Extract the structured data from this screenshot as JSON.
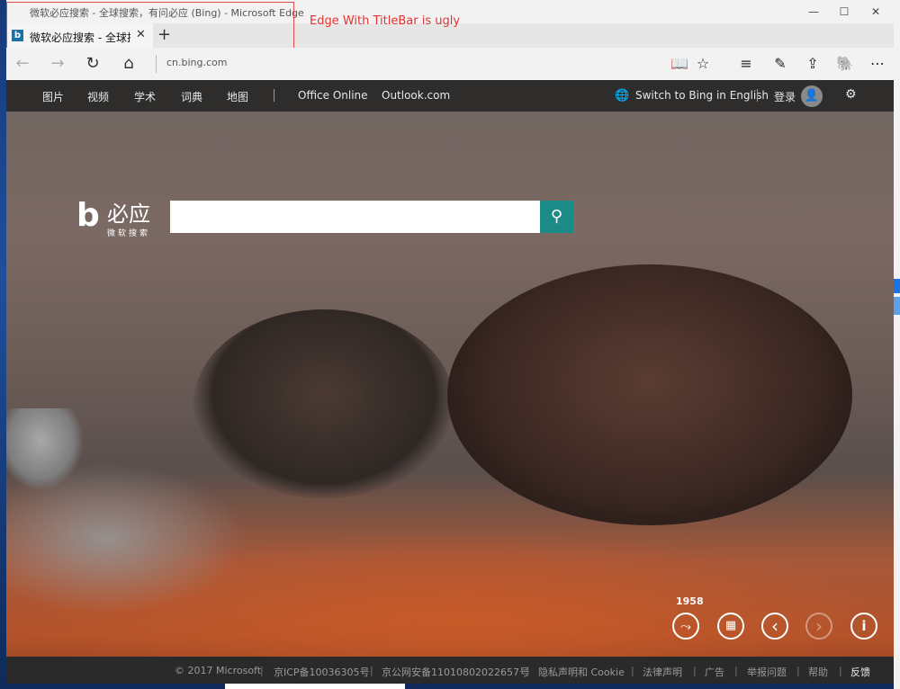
{
  "window": {
    "title": "微软必应搜索 - 全球搜索，有问必应 (Bing) - Microsoft Edge",
    "minimize": "—",
    "maximize": "☐",
    "close": "✕"
  },
  "tab": {
    "label": "微软必应搜索 - 全球搜索",
    "favicon": "b",
    "close": "✕",
    "new_tab": "+"
  },
  "annotation": "Edge With TitleBar is ugly",
  "address_bar": {
    "url": "cn.bing.com",
    "back": "←",
    "forward": "→",
    "refresh": "↻",
    "home": "⌂"
  },
  "toolbar": {
    "reading_view": "📖",
    "favorite": "☆",
    "hub": "≡",
    "notes": "✎",
    "share": "⇪",
    "evernote": "🐘",
    "more": "⋯"
  },
  "bing_nav": {
    "links": [
      "图片",
      "视频",
      "学术",
      "词典",
      "地图"
    ],
    "office": "Office Online",
    "outlook": "Outlook.com",
    "switch_lang": "Switch to Bing in English",
    "login": "登录"
  },
  "logo": {
    "mark": "b",
    "name": "必应",
    "subtitle": "微软搜索"
  },
  "search": {
    "value": "",
    "button_icon": "⚲"
  },
  "image_controls": {
    "year": "1958",
    "share": "⤳",
    "qr": "▦",
    "prev": "‹",
    "next": "›",
    "info": "i"
  },
  "footer": {
    "copyright": "© 2017 Microsoft",
    "icp": "京ICP备10036305号",
    "police": "京公网安备11010802022657号",
    "privacy": "隐私声明和 Cookie",
    "legal": "法律声明",
    "ads": "广告",
    "report": "举报问题",
    "help": "帮助",
    "feedback": "反馈"
  }
}
